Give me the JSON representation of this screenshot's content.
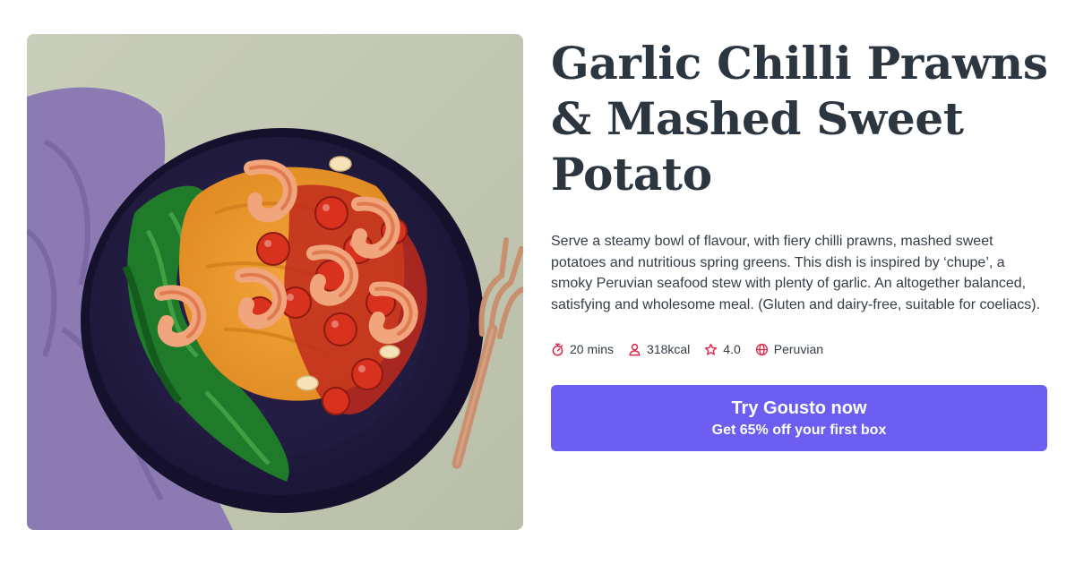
{
  "recipe": {
    "title": "Garlic Chilli Prawns & Mashed Sweet Potato",
    "description": "Serve a steamy bowl of flavour, with fiery chilli prawns, mashed sweet potatoes and nutritious spring greens. This dish is inspired by ‘chupe’, a smoky Peruvian seafood stew with plenty of garlic. An altogether balanced, satisfying and wholesome meal. (Gluten and dairy-free, suitable for coeliacs).",
    "meta": {
      "time": "20 mins",
      "calories": "318kcal",
      "rating": "4.0",
      "cuisine": "Peruvian"
    },
    "meta_icons": [
      "stopwatch-icon",
      "person-icon",
      "star-icon",
      "globe-icon"
    ],
    "meta_icon_color": "#e0284a"
  },
  "cta": {
    "title": "Try Gousto now",
    "subtitle": "Get 65% off your first box",
    "color": "#6b5ef0"
  }
}
